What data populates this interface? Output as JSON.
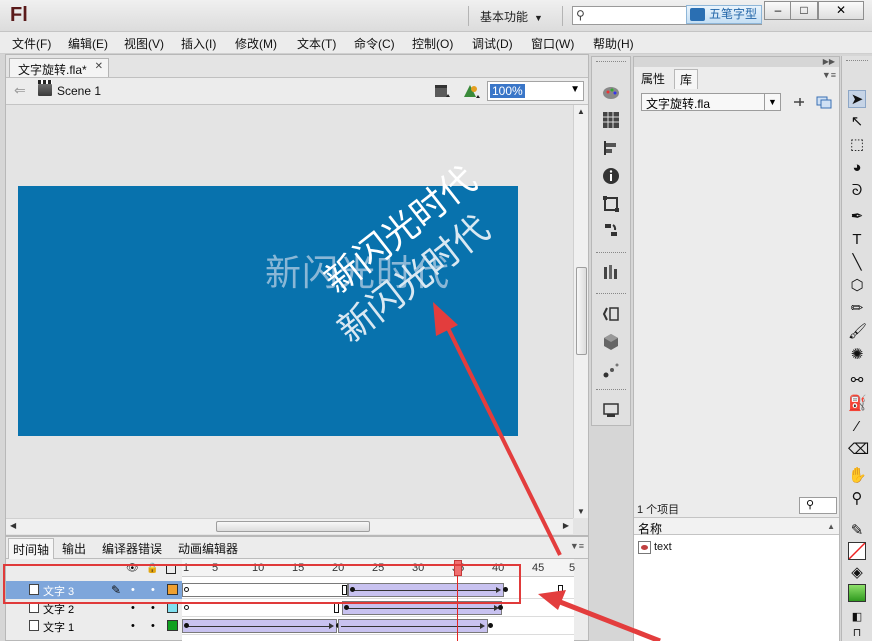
{
  "app": {
    "logo": "Fl",
    "workspace": "基本功能",
    "ime_label": "五笔字型",
    "window_controls": [
      "–",
      "□",
      "✕"
    ]
  },
  "menu": [
    "文件(F)",
    "编辑(E)",
    "视图(V)",
    "插入(I)",
    "修改(M)",
    "文本(T)",
    "命令(C)",
    "控制(O)",
    "调试(D)",
    "窗口(W)",
    "帮助(H)"
  ],
  "document": {
    "tab_title": "文字旋转.fla*",
    "scene": "Scene 1",
    "zoom": "100%"
  },
  "stage": {
    "background": "#0872ad",
    "static_text": "新闪光时代",
    "rotated_text": "新闪光时代"
  },
  "timeline": {
    "tabs": [
      "时间轴",
      "输出",
      "编译器错误",
      "动画编辑器"
    ],
    "ruler": [
      "1",
      "5",
      "10",
      "15",
      "20",
      "25",
      "30",
      "35",
      "40",
      "45",
      "5"
    ],
    "current_frame": 35,
    "layers": [
      {
        "name": "文字 3",
        "selected": true,
        "color": "#f0a030"
      },
      {
        "name": "文字 2",
        "selected": false,
        "color": "#80e0f0"
      },
      {
        "name": "文字 1",
        "selected": false,
        "color": "#10a020"
      }
    ]
  },
  "library": {
    "tabs": [
      "属性",
      "库"
    ],
    "active_tab": "库",
    "file": "文字旋转.fla",
    "item_count": "1 个项目",
    "column_name": "名称",
    "items": [
      "text"
    ]
  },
  "colors": {
    "accent": "#3a76c8",
    "annotation_red": "#e03a3a",
    "tween": "#c8c2f0"
  }
}
